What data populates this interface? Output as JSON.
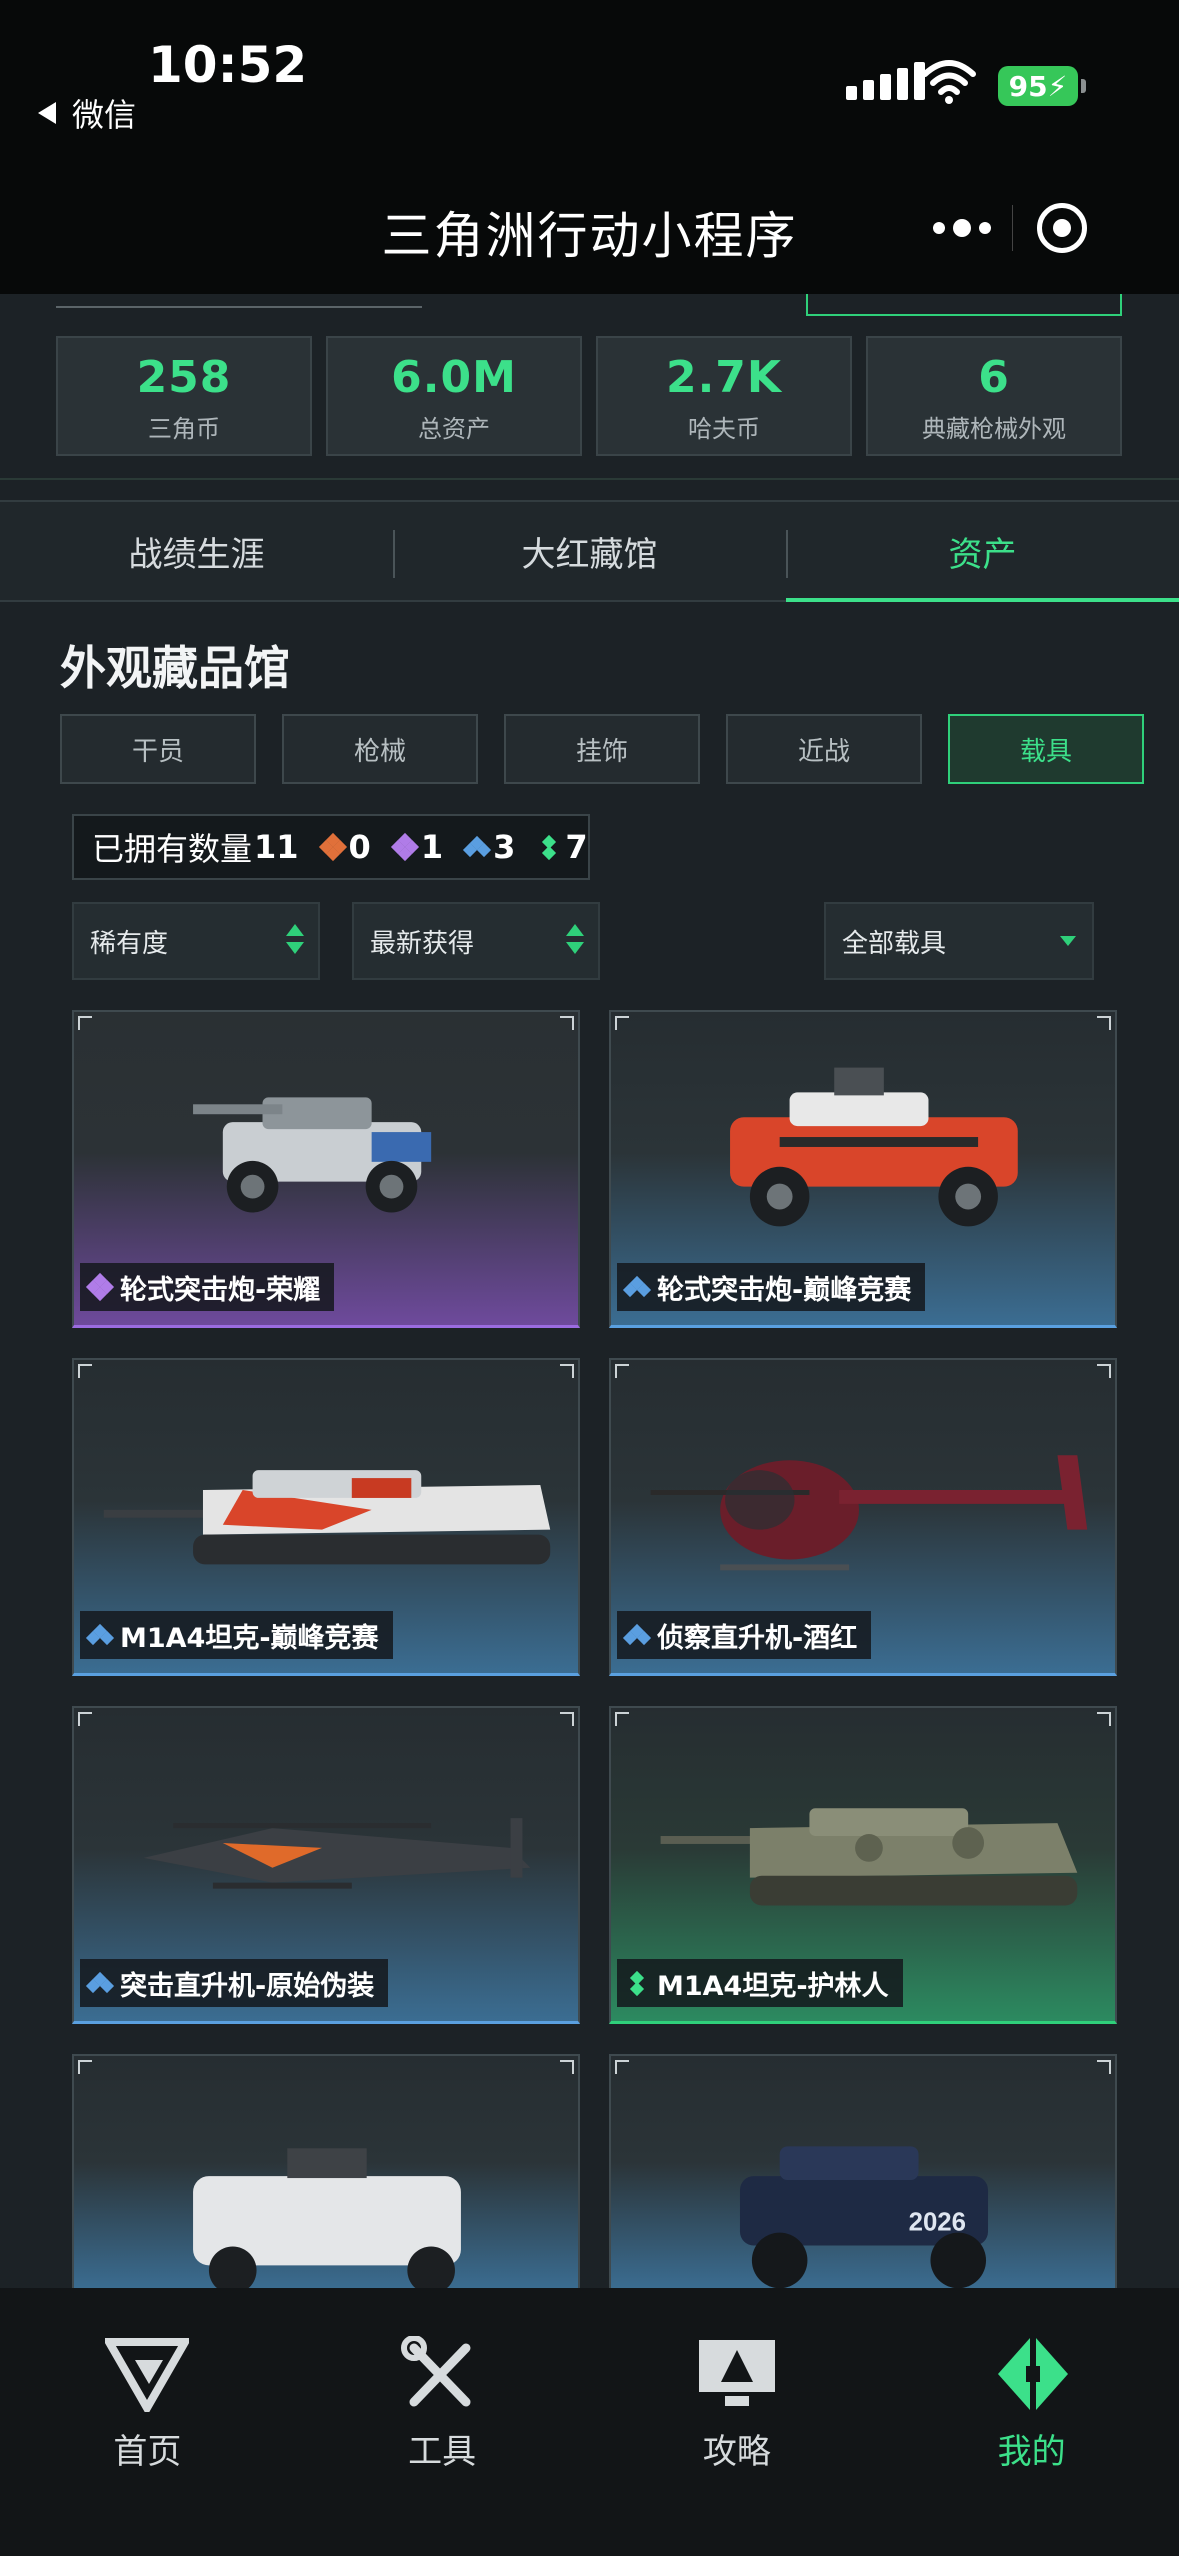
{
  "status": {
    "time": "10:52",
    "battery": "95",
    "back_label": "微信"
  },
  "header": {
    "title": "三角洲行动小程序"
  },
  "stats": [
    {
      "value": "258",
      "label": "三角币"
    },
    {
      "value": "6.0M",
      "label": "总资产"
    },
    {
      "value": "2.7K",
      "label": "哈夫币"
    },
    {
      "value": "6",
      "label": "典藏枪械外观"
    }
  ],
  "tabs": [
    {
      "label": "战绩生涯",
      "active": false
    },
    {
      "label": "大红藏馆",
      "active": false
    },
    {
      "label": "资产",
      "active": true
    }
  ],
  "section_title": "外观藏品馆",
  "subtabs": [
    {
      "label": "干员"
    },
    {
      "label": "枪械"
    },
    {
      "label": "挂饰"
    },
    {
      "label": "近战"
    },
    {
      "label": "载具",
      "active": true
    }
  ],
  "owned": {
    "label": "已拥有数量",
    "total": "11",
    "counts": [
      {
        "value": "0",
        "color": "#e0703a"
      },
      {
        "value": "1",
        "color": "#b07ce8"
      },
      {
        "value": "3",
        "color": "#5a9ee0"
      },
      {
        "value": "7",
        "color": "#3ce08a"
      }
    ]
  },
  "filters": {
    "rarity": "稀有度",
    "sort": "最新获得",
    "type": "全部载具"
  },
  "items": [
    {
      "name": "轮式突击炮-荣耀",
      "rarity": "purple",
      "color": "#b07ce8",
      "kind": "buggy-gray"
    },
    {
      "name": "轮式突击炮-巅峰竞赛",
      "rarity": "blue",
      "color": "#5a9ee0",
      "kind": "buggy-red"
    },
    {
      "name": "M1A4坦克-巅峰竞赛",
      "rarity": "blue",
      "color": "#5a9ee0",
      "kind": "tank-red"
    },
    {
      "name": "侦察直升机-酒红",
      "rarity": "blue",
      "color": "#5a9ee0",
      "kind": "heli-wine"
    },
    {
      "name": "突击直升机-原始伪装",
      "rarity": "blue",
      "color": "#5a9ee0",
      "kind": "apache"
    },
    {
      "name": "M1A4坦克-护林人",
      "rarity": "green",
      "color": "#3ce08a",
      "kind": "tank-camo"
    }
  ],
  "nav": [
    {
      "label": "首页",
      "icon": "delta-logo-icon"
    },
    {
      "label": "工具",
      "icon": "tools-icon"
    },
    {
      "label": "攻略",
      "icon": "guide-screen-icon"
    },
    {
      "label": "我的",
      "icon": "profile-logo-icon",
      "active": true
    }
  ]
}
